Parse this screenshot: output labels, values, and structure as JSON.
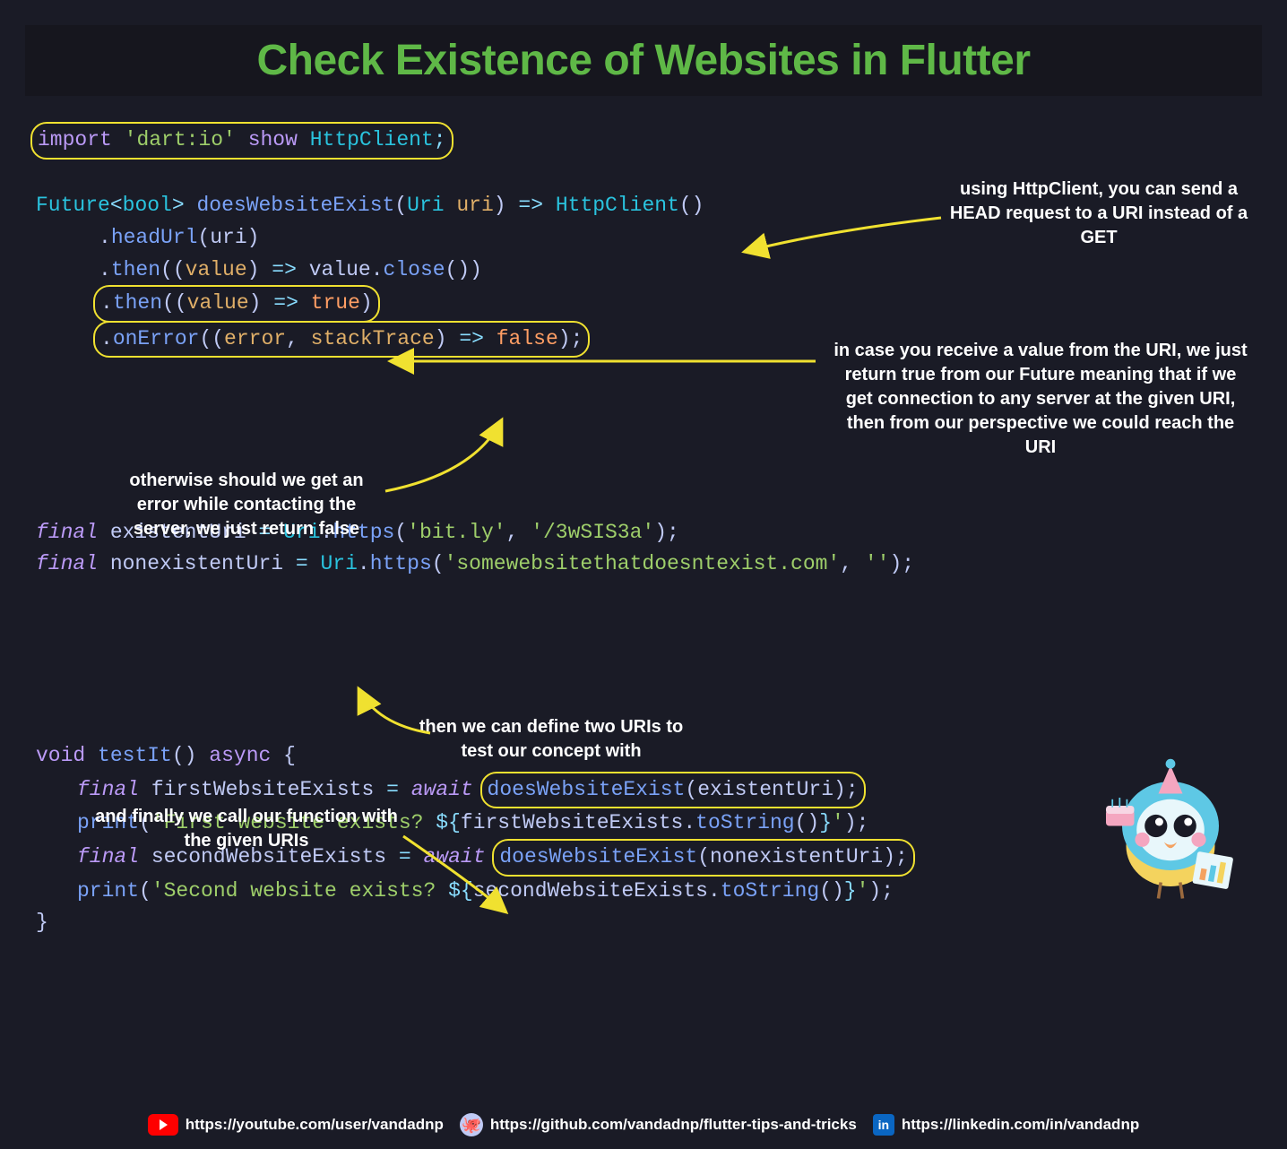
{
  "title": "Check Existence of Websites in Flutter",
  "code": {
    "import_kw": "import",
    "import_str": "'dart:io'",
    "show_kw": "show",
    "import_cls": "HttpClient",
    "future": "Future",
    "bool": "bool",
    "fn_name": "doesWebsiteExist",
    "uri_type": "Uri",
    "uri_param": "uri",
    "httpclient": "HttpClient",
    "headUrl": "headUrl",
    "then": "then",
    "value": "value",
    "close": "close",
    "true": "true",
    "onError": "onError",
    "error": "error",
    "stackTrace": "stackTrace",
    "false": "false",
    "final": "final",
    "existentUri": "existentUri",
    "https": "https",
    "bitly": "'bit.ly'",
    "bitly_path": "'/3wSIS3a'",
    "nonexistentUri": "nonexistentUri",
    "nonexistent_host": "'somewebsitethatdoesntexist.com'",
    "empty": "''",
    "void": "void",
    "testIt": "testIt",
    "async": "async",
    "firstWebsiteExists": "firstWebsiteExists",
    "await": "await",
    "print": "print",
    "first_str": "'First website exists? ",
    "toString": "toString",
    "secondWebsiteExists": "secondWebsiteExists",
    "second_str": "'Second website exists? "
  },
  "annotations": {
    "a1": "using HttpClient, you can send a HEAD request to a URI instead of a GET",
    "a2": "in case you receive a value from the URI, we just return true from our Future meaning that if we get connection to any server at the given URI, then from our perspective we could reach the URI",
    "a3": "otherwise should we get an error while contacting the server, we just return false",
    "a4": "then we can define two URIs to test our concept with",
    "a5": "and finally we call our function with the given URIs"
  },
  "footer": {
    "youtube": "https://youtube.com/user/vandadnp",
    "github": "https://github.com/vandadnp/flutter-tips-and-tricks",
    "linkedin": "https://linkedin.com/in/vandadnp"
  }
}
